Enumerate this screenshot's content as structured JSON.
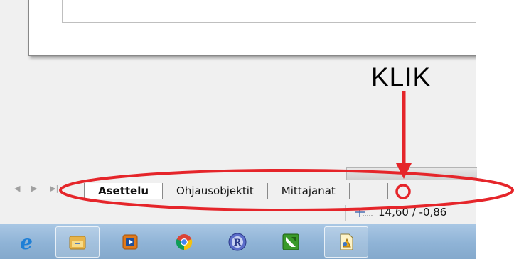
{
  "annotation": {
    "label": "KLIK",
    "color": "#e5252a"
  },
  "tabbar": {
    "tabs": [
      {
        "label": "Asettelu",
        "active": true
      },
      {
        "label": "Ohjausobjektit",
        "active": false
      },
      {
        "label": "Mittajanat",
        "active": false
      }
    ]
  },
  "statusbar": {
    "coordinates": "14,60 / -0,86"
  },
  "taskbar": {
    "items": [
      {
        "icon": "internet-explorer-icon",
        "open": false
      },
      {
        "icon": "file-explorer-icon",
        "open": true
      },
      {
        "icon": "media-player-icon",
        "open": false
      },
      {
        "icon": "chrome-icon",
        "open": false
      },
      {
        "icon": "r-icon",
        "open": false
      },
      {
        "icon": "green-app-icon",
        "open": false
      },
      {
        "icon": "libreoffice-draw-icon",
        "open": true
      }
    ]
  }
}
